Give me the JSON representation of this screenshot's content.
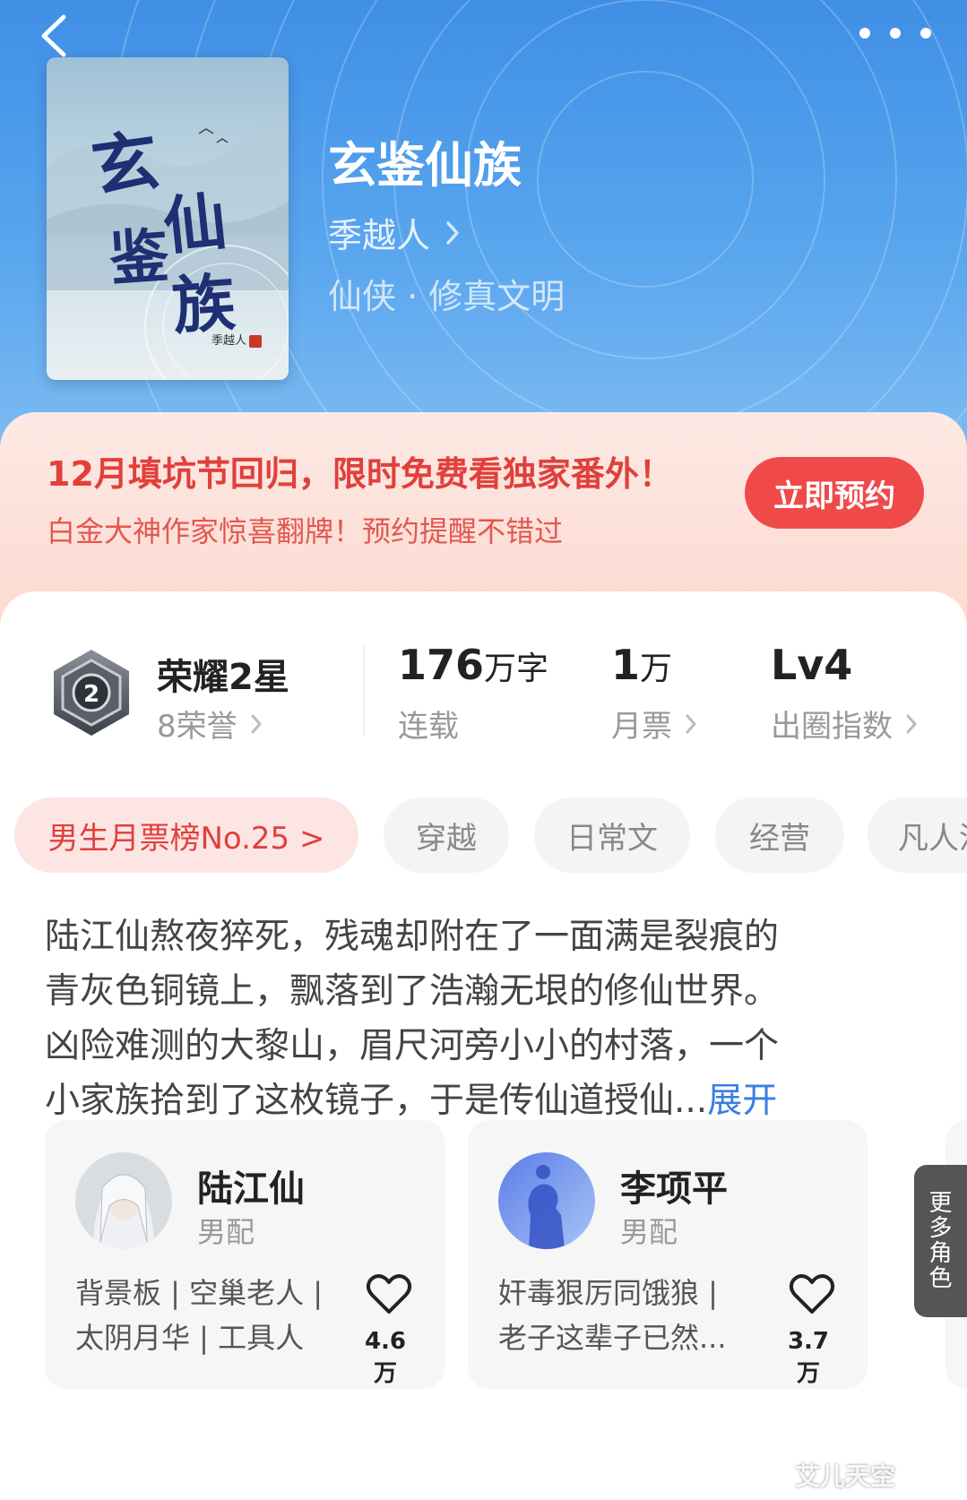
{
  "header": {
    "back_icon": "chevron-left-icon",
    "more_icon": "more-dots-icon"
  },
  "book": {
    "cover_title_chars": [
      "玄",
      "鉴",
      "仙",
      "族"
    ],
    "cover_author": "季越人",
    "title": "玄鉴仙族",
    "author": "季越人",
    "genre": "仙侠 · 修真文明"
  },
  "promo": {
    "title": "12月填坑节回归，限时免费看独家番外！",
    "subtitle": "白金大神作家惊喜翻牌！预约提醒不错过",
    "button": "立即预约",
    "accent": "#f0494a"
  },
  "stats": {
    "honor": {
      "title": "荣耀2星",
      "sub": "8荣誉",
      "badge_number": "2"
    },
    "items": [
      {
        "value": "176",
        "unit": "万字",
        "label": "连载"
      },
      {
        "value": "1",
        "unit": "万",
        "label": "月票"
      },
      {
        "value": "Lv4",
        "unit": "",
        "label": "出圈指数"
      }
    ]
  },
  "tags": [
    "男生月票榜No.25 >",
    "穿越",
    "日常文",
    "经营",
    "凡人流"
  ],
  "description": {
    "lines": [
      "陆江仙熬夜猝死，残魂却附在了一面满是裂痕的",
      "青灰色铜镜上，飘落到了浩瀚无垠的修仙世界。",
      "凶险难测的大黎山，眉尺河旁小小的村落，一个",
      "小家族拾到了这枚镜子，于是传仙道授仙..."
    ],
    "expand": "展开"
  },
  "characters": [
    {
      "name": "陆江仙",
      "role": "男配",
      "tags": [
        "背景板 | 空巢老人 |",
        "太阴月华 | 工具人"
      ],
      "likes": "4.6万"
    },
    {
      "name": "李项平",
      "role": "男配",
      "tags": [
        "奸毒狠厉同饿狼 |",
        "老子这辈子已然..."
      ],
      "likes": "3.7万"
    }
  ],
  "more_roles": [
    "更",
    "多",
    "角",
    "色"
  ],
  "watermark": "艾儿天空"
}
